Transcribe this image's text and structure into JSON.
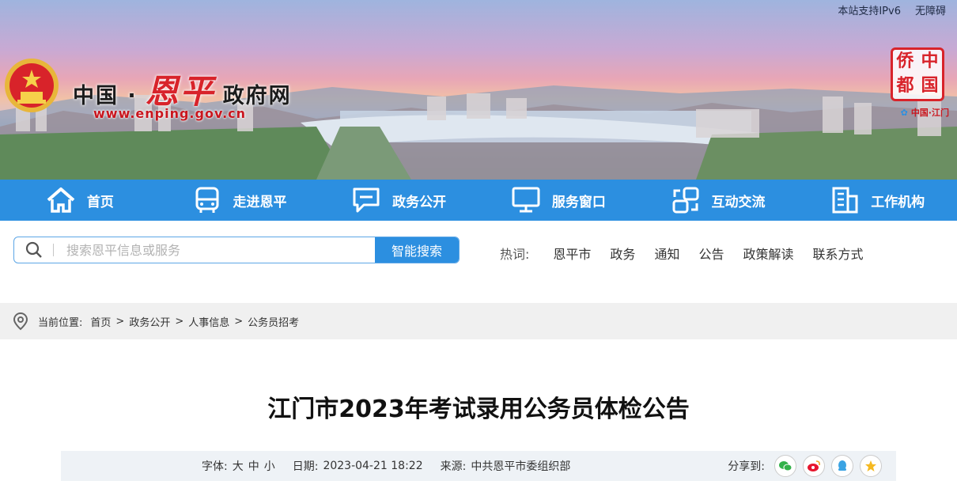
{
  "top_links": [
    "本站支持IPv6",
    "无障碍"
  ],
  "site": {
    "title_prefix": "中国 ·",
    "title_calligraphy": "恩平",
    "title_suffix": "政府网",
    "url": "www.enping.gov.cn",
    "seal_chars": [
      "侨",
      "中",
      "都",
      "国"
    ],
    "seal_caption": "中国·江门"
  },
  "nav": [
    {
      "label": "首页",
      "icon": "home-icon"
    },
    {
      "label": "走进恩平",
      "icon": "bus-icon"
    },
    {
      "label": "政务公开",
      "icon": "chat-icon"
    },
    {
      "label": "服务窗口",
      "icon": "monitor-icon"
    },
    {
      "label": "互动交流",
      "icon": "interact-icon"
    },
    {
      "label": "工作机构",
      "icon": "building-icon"
    }
  ],
  "search": {
    "placeholder": "搜索恩平信息或服务",
    "button": "智能搜索"
  },
  "hot": {
    "label": "热词:",
    "keywords": [
      "恩平市",
      "政务",
      "通知",
      "公告",
      "政策解读",
      "联系方式"
    ]
  },
  "breadcrumb": {
    "label": "当前位置:",
    "items": [
      "首页",
      "政务公开",
      "人事信息",
      "公务员招考"
    ]
  },
  "article": {
    "title": "江门市2023年考试录用公务员体检公告",
    "font_label": "字体:",
    "font_sizes": [
      "大",
      "中",
      "小"
    ],
    "date_label": "日期:",
    "date": "2023-04-21 18:22",
    "source_label": "来源:",
    "source": "中共恩平市委组织部",
    "share_label": "分享到:"
  },
  "colors": {
    "nav_bg": "#2c8fe0",
    "accent_red": "#d8232a"
  }
}
